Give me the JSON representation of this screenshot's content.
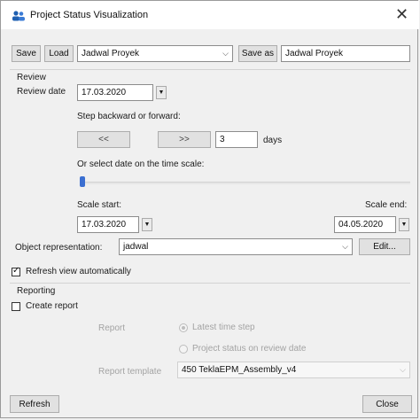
{
  "window": {
    "title": "Project Status Visualization",
    "close_glyph": "✕"
  },
  "toolbar": {
    "save_label": "Save",
    "load_label": "Load",
    "setting_value": "Jadwal Proyek",
    "save_as_label": "Save as",
    "save_as_value": "Jadwal Proyek"
  },
  "review": {
    "group_label": "Review",
    "date_label": "Review date",
    "date_value": "17.03.2020",
    "step_label": "Step backward or forward:",
    "back_label": "<<",
    "forward_label": ">>",
    "step_value": "3",
    "step_unit": "days",
    "timescale_label": "Or select date on the time scale:",
    "scale_start_label": "Scale start:",
    "scale_start_value": "17.03.2020",
    "scale_end_label": "Scale end:",
    "scale_end_value": "04.05.2020",
    "object_rep_label": "Object representation:",
    "object_rep_value": "jadwal",
    "edit_label": "Edit...",
    "refresh_auto_label": "Refresh view automatically",
    "refresh_auto_checked": true
  },
  "reporting": {
    "group_label": "Reporting",
    "create_report_label": "Create report",
    "create_report_checked": false,
    "report_label": "Report",
    "option_latest": "Latest time step",
    "option_review": "Project status on review date",
    "template_label": "Report template",
    "template_value": "450  TeklaEPM_Assembly_v4"
  },
  "footer": {
    "refresh_label": "Refresh",
    "close_label": "Close"
  }
}
